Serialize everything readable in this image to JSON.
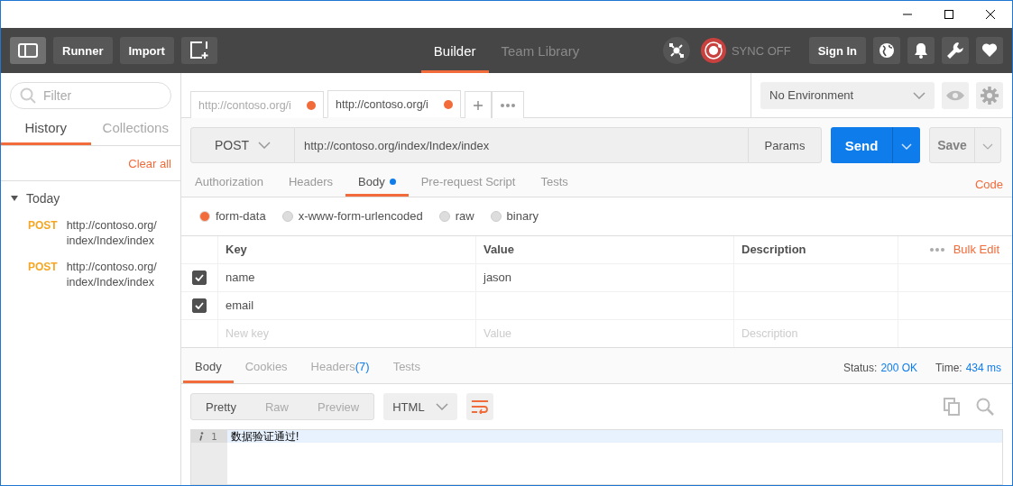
{
  "header": {
    "buttons": [
      "Runner",
      "Import"
    ],
    "tabs": [
      {
        "label": "Builder",
        "selected": true
      },
      {
        "label": "Team Library",
        "selected": false
      }
    ],
    "sync": {
      "label": "SYNC OFF",
      "on": false
    },
    "sign_in": "Sign In"
  },
  "sidebar": {
    "filter_placeholder": "Filter",
    "tabs": [
      {
        "label": "History",
        "selected": true
      },
      {
        "label": "Collections",
        "selected": false
      }
    ],
    "clear_all": "Clear all",
    "groups": [
      {
        "label": "Today",
        "expanded": true,
        "items": [
          {
            "method": "POST",
            "url": "http://contoso.org/index/Index/index"
          },
          {
            "method": "POST",
            "url": "http://contoso.org/index/Index/index"
          }
        ]
      }
    ]
  },
  "request_tabs": [
    {
      "label": "http://contoso.org/i",
      "selected": false,
      "unsaved": true
    },
    {
      "label": "http://contoso.org/i",
      "selected": true,
      "unsaved": true
    }
  ],
  "environment": "No Environment",
  "request": {
    "method": "POST",
    "url": "http://contoso.org/index/Index/index",
    "params": "Params",
    "send": "Send",
    "save": "Save"
  },
  "request_sections": [
    {
      "label": "Authorization",
      "selected": false,
      "dot": false
    },
    {
      "label": "Headers",
      "selected": false,
      "dot": false
    },
    {
      "label": "Body",
      "selected": true,
      "dot": true
    },
    {
      "label": "Pre-request Script",
      "selected": false,
      "dot": false
    },
    {
      "label": "Tests",
      "selected": false,
      "dot": false
    }
  ],
  "code_link": "Code",
  "body_modes": [
    {
      "label": "form-data",
      "selected": true
    },
    {
      "label": "x-www-form-urlencoded",
      "selected": false
    },
    {
      "label": "raw",
      "selected": false
    },
    {
      "label": "binary",
      "selected": false
    }
  ],
  "form_table": {
    "columns": [
      "Key",
      "Value",
      "Description"
    ],
    "bulk_edit": "Bulk Edit",
    "rows": [
      {
        "checked": true,
        "key": "name",
        "value": "jason"
      },
      {
        "checked": true,
        "key": "email"
      }
    ],
    "new_row": {
      "key_placeholder": "New key",
      "value_placeholder": "Value",
      "description_placeholder": "Description"
    }
  },
  "response": {
    "tabs": [
      {
        "label": "Body",
        "selected": true
      },
      {
        "label": "Cookies",
        "selected": false
      },
      {
        "label": "Headers",
        "count": "(7)",
        "selected": false
      },
      {
        "label": "Tests",
        "selected": false
      }
    ],
    "status_label": "Status:",
    "status": "200 OK",
    "time_label": "Time:",
    "time": "434 ms",
    "view_modes": [
      {
        "label": "Pretty",
        "selected": true
      },
      {
        "label": "Raw",
        "selected": false
      },
      {
        "label": "Preview",
        "selected": false
      }
    ],
    "format": "HTML",
    "lines": [
      {
        "number": "1",
        "text": "数据验证通过!"
      }
    ]
  }
}
